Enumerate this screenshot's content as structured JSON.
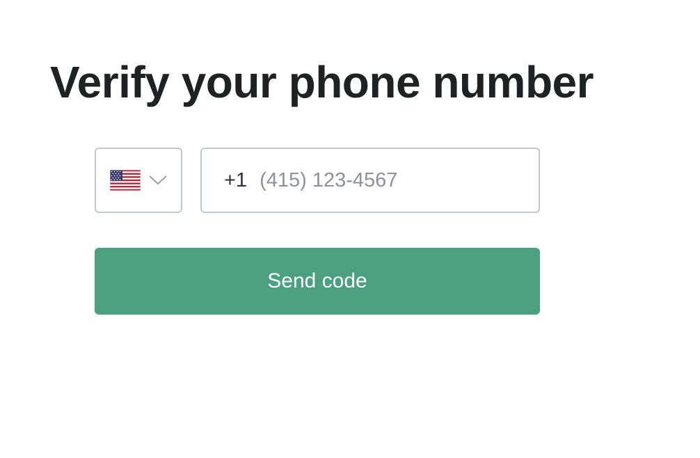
{
  "page": {
    "title": "Verify your phone number"
  },
  "country_select": {
    "selected_flag_icon": "us-flag-icon",
    "chevron_icon": "chevron-down-icon"
  },
  "phone": {
    "country_code": "+1",
    "value": "",
    "placeholder": "(415) 123-4567"
  },
  "send_button": {
    "label": "Send code",
    "color": "#4aa081"
  },
  "colors": {
    "title_text": "#202123",
    "field_border": "#c2c8d0",
    "placeholder_text": "#8e919c",
    "button_text": "#ffffff"
  }
}
